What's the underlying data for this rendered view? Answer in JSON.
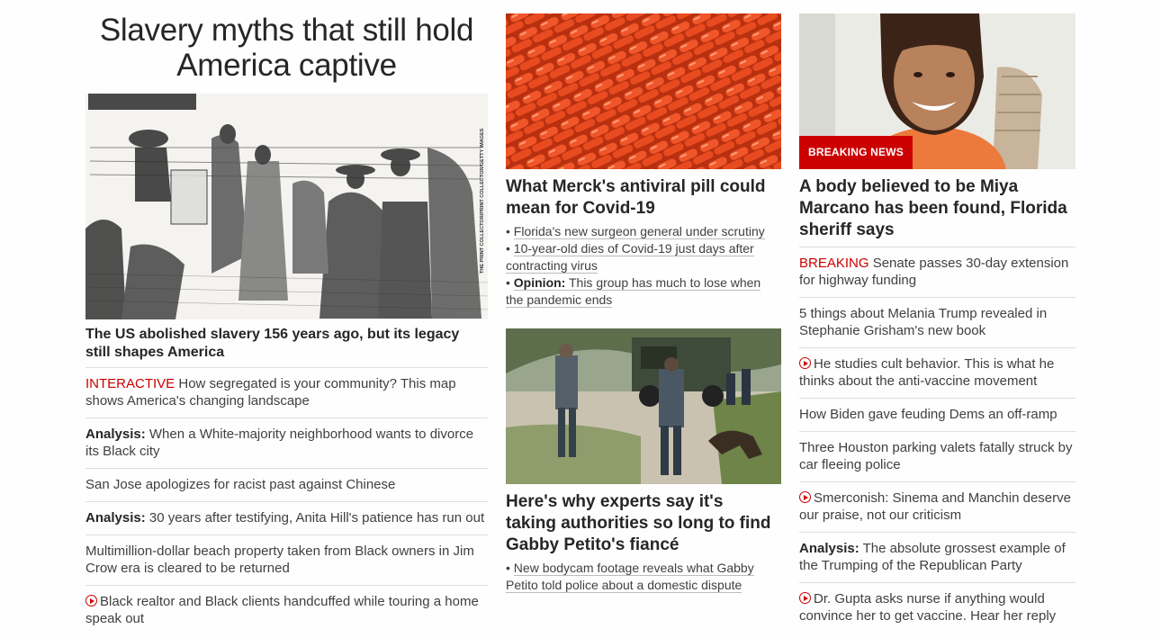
{
  "col1": {
    "title": "Slavery myths that still hold America captive",
    "image_credit": "THE PRINT COLLECTOR/PRINT COLLECTOR/GETTY IMAGES",
    "headline": "The US abolished slavery 156 years ago, but its legacy still shapes America",
    "items": [
      {
        "tag": "INTERACTIVE",
        "text": "How segregated is your community? This map shows America's changing landscape"
      },
      {
        "tag": "Analysis:",
        "text": "When a White-majority neighborhood wants to divorce its Black city"
      },
      {
        "text": "San Jose apologizes for racist past against Chinese"
      },
      {
        "tag": "Analysis:",
        "text": "30 years after testifying, Anita Hill's patience has run out"
      },
      {
        "text": "Multimillion-dollar beach property taken from Black owners in Jim Crow era is cleared to be returned"
      },
      {
        "text": "Black realtor and Black clients handcuffed while touring a home speak out"
      }
    ]
  },
  "col2": {
    "story1": {
      "headline": "What Merck's antiviral pill could mean for Covid-19",
      "bullets": [
        {
          "text": "Florida's new surgeon general under scrutiny"
        },
        {
          "text": "10-year-old dies of Covid-19 just days after contracting virus"
        },
        {
          "tag": "Opinion:",
          "text": "This group has much to lose when the pandemic ends"
        }
      ]
    },
    "story2": {
      "headline": "Here's why experts say it's taking authorities so long to find Gabby Petito's fiancé",
      "bullets": [
        {
          "text": "New bodycam footage reveals what Gabby Petito told police about a domestic dispute"
        }
      ]
    }
  },
  "col3": {
    "badge": "BREAKING NEWS",
    "headline": "A body believed to be Miya Marcano has been found, Florida sheriff says",
    "items": [
      {
        "tag": "BREAKING",
        "text": "Senate passes 30-day extension for highway funding"
      },
      {
        "text": "5 things about Melania Trump revealed in Stephanie Grisham's new book"
      },
      {
        "text": "He studies cult behavior. This is what he thinks about the anti-vaccine movement"
      },
      {
        "text": "How Biden gave feuding Dems an off-ramp"
      },
      {
        "text": "Three Houston parking valets fatally struck by car fleeing police"
      },
      {
        "text": "Smerconish: Sinema and Manchin deserve our praise, not our criticism"
      },
      {
        "tag": "Analysis:",
        "text": "The absolute grossest example of the Trumping of the Republican Party"
      },
      {
        "text": "Dr. Gupta asks nurse if anything would convince her to get vaccine. Hear her reply"
      }
    ]
  },
  "colors": {
    "accent_red": "#cc0000",
    "text": "#262626"
  }
}
